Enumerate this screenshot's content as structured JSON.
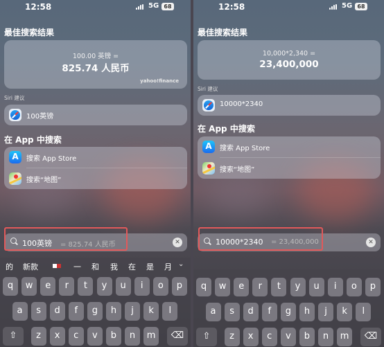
{
  "screens": [
    {
      "status": {
        "time": "12:58",
        "network": "5G",
        "battery": "68"
      },
      "best_result": {
        "title": "最佳搜索结果",
        "line1": "100.00 英镑 =",
        "line2": "825.74 人民币",
        "source": "yahoo!finance"
      },
      "siri": {
        "label": "Siri 建议",
        "suggestion": "100英镑"
      },
      "app_search": {
        "title": "在 App 中搜索",
        "items": [
          "搜索 App Store",
          "搜索“地图”"
        ]
      },
      "search": {
        "query": "100英镑",
        "hint": "= 825.74 人民币"
      },
      "candidates": [
        "的",
        "新款",
        "一",
        "和",
        "我",
        "在",
        "是",
        "月"
      ]
    },
    {
      "status": {
        "time": "12:58",
        "network": "5G",
        "battery": "68"
      },
      "best_result": {
        "title": "最佳搜索结果",
        "line1": "10,000*2,340 =",
        "line2": "23,400,000"
      },
      "siri": {
        "label": "Siri 建议",
        "suggestion": "10000*2340"
      },
      "app_search": {
        "title": "在 App 中搜索",
        "items": [
          "搜索 App Store",
          "搜索“地图”"
        ]
      },
      "search": {
        "query": "10000*2340",
        "hint": "= 23,400,000"
      }
    }
  ],
  "keyboard": {
    "row1": [
      "q",
      "w",
      "e",
      "r",
      "t",
      "y",
      "u",
      "i",
      "o",
      "p"
    ],
    "row2": [
      "a",
      "s",
      "d",
      "f",
      "g",
      "h",
      "j",
      "k",
      "l"
    ],
    "row3": [
      "z",
      "x",
      "c",
      "v",
      "b",
      "n",
      "m"
    ],
    "backspace_icon": "backspace-icon",
    "shift_icon": "shift-icon"
  },
  "colors": {
    "highlight_border": "#e2595a",
    "card_bg": "#cdd2de"
  }
}
